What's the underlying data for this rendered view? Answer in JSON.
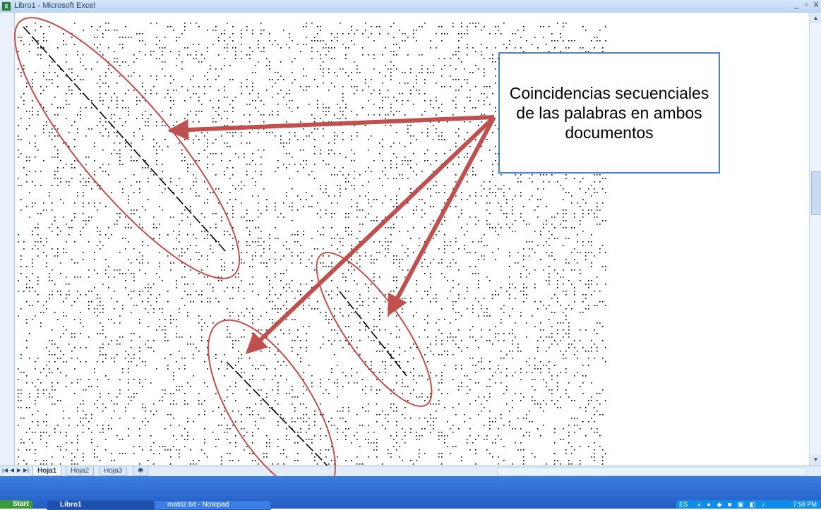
{
  "window": {
    "title": "Libro1 - Microsoft Excel",
    "app_icon_text": "X",
    "minimize": "_",
    "restore": "▫",
    "close": "X"
  },
  "sheet_tabs": [
    "Hoja1",
    "Hoja2",
    "Hoja3"
  ],
  "active_tab": "Hoja1",
  "nav_buttons": [
    "|◀",
    "◀",
    "▶",
    "▶|"
  ],
  "callout": {
    "text": "Coincidencias secuenciales de las palabras en ambos documentos",
    "border_color": "#4f81bd"
  },
  "annotation_color": "#c0504d",
  "taskbar": {
    "start_label": "Start",
    "items": [
      {
        "label": "Libro1",
        "active": true
      },
      {
        "label": "matriz.txt - Notepad",
        "active": false
      }
    ],
    "language": "ES",
    "clock": "7:58 PM"
  }
}
